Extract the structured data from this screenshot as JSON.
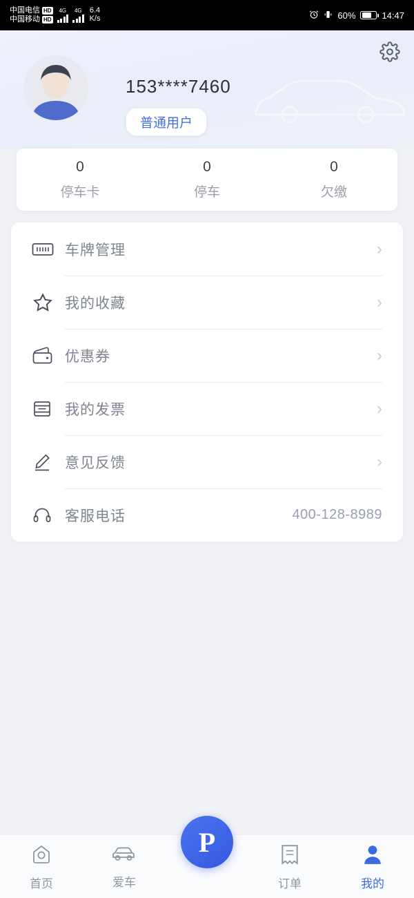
{
  "status_bar": {
    "carrier1": "中国电信",
    "carrier1_badge": "HD",
    "carrier2": "中国移动",
    "carrier2_badge": "HD",
    "net1": "4G",
    "net2": "4G",
    "speed_value": "6.4",
    "speed_unit": "K/s",
    "battery_percent": "60%",
    "time": "14:47",
    "alarm_icon": "alarm-clock-icon",
    "vibrate_icon": "vibrate-icon",
    "battery_icon": "battery-icon"
  },
  "header": {
    "settings_icon": "gear-icon",
    "avatar": "user-avatar",
    "car_watermark": "car-outline-icon",
    "phone_number": "153****7460",
    "level_label": "普通用户"
  },
  "stats": [
    {
      "value": "0",
      "label": "停车卡"
    },
    {
      "value": "0",
      "label": "停车"
    },
    {
      "value": "0",
      "label": "欠缴"
    }
  ],
  "menu": [
    {
      "icon": "license-plate-icon",
      "label": "车牌管理",
      "value": "",
      "chevron": "›"
    },
    {
      "icon": "star-icon",
      "label": "我的收藏",
      "value": "",
      "chevron": "›"
    },
    {
      "icon": "wallet-icon",
      "label": "优惠券",
      "value": "",
      "chevron": "›"
    },
    {
      "icon": "invoice-icon",
      "label": "我的发票",
      "value": "",
      "chevron": "›"
    },
    {
      "icon": "pencil-icon",
      "label": "意见反馈",
      "value": "",
      "chevron": "›"
    },
    {
      "icon": "headset-icon",
      "label": "客服电话",
      "value": "400-128-8989",
      "chevron": ""
    }
  ],
  "tabbar": {
    "items": [
      {
        "label": "首页",
        "icon": "home-icon",
        "active": false
      },
      {
        "label": "爱车",
        "icon": "car-icon",
        "active": false
      },
      {
        "label": "订单",
        "icon": "order-icon",
        "active": false
      },
      {
        "label": "我的",
        "icon": "person-icon",
        "active": true
      }
    ],
    "fab_label": "P",
    "fab_icon": "parking-fab-icon"
  },
  "colors": {
    "accent": "#3d6ae0",
    "fab": "#3b62e6",
    "text_primary": "#3a3f4b",
    "text_muted": "#9a9ea9",
    "card_bg": "#ffffff",
    "page_bg": "#f2f3f7"
  }
}
